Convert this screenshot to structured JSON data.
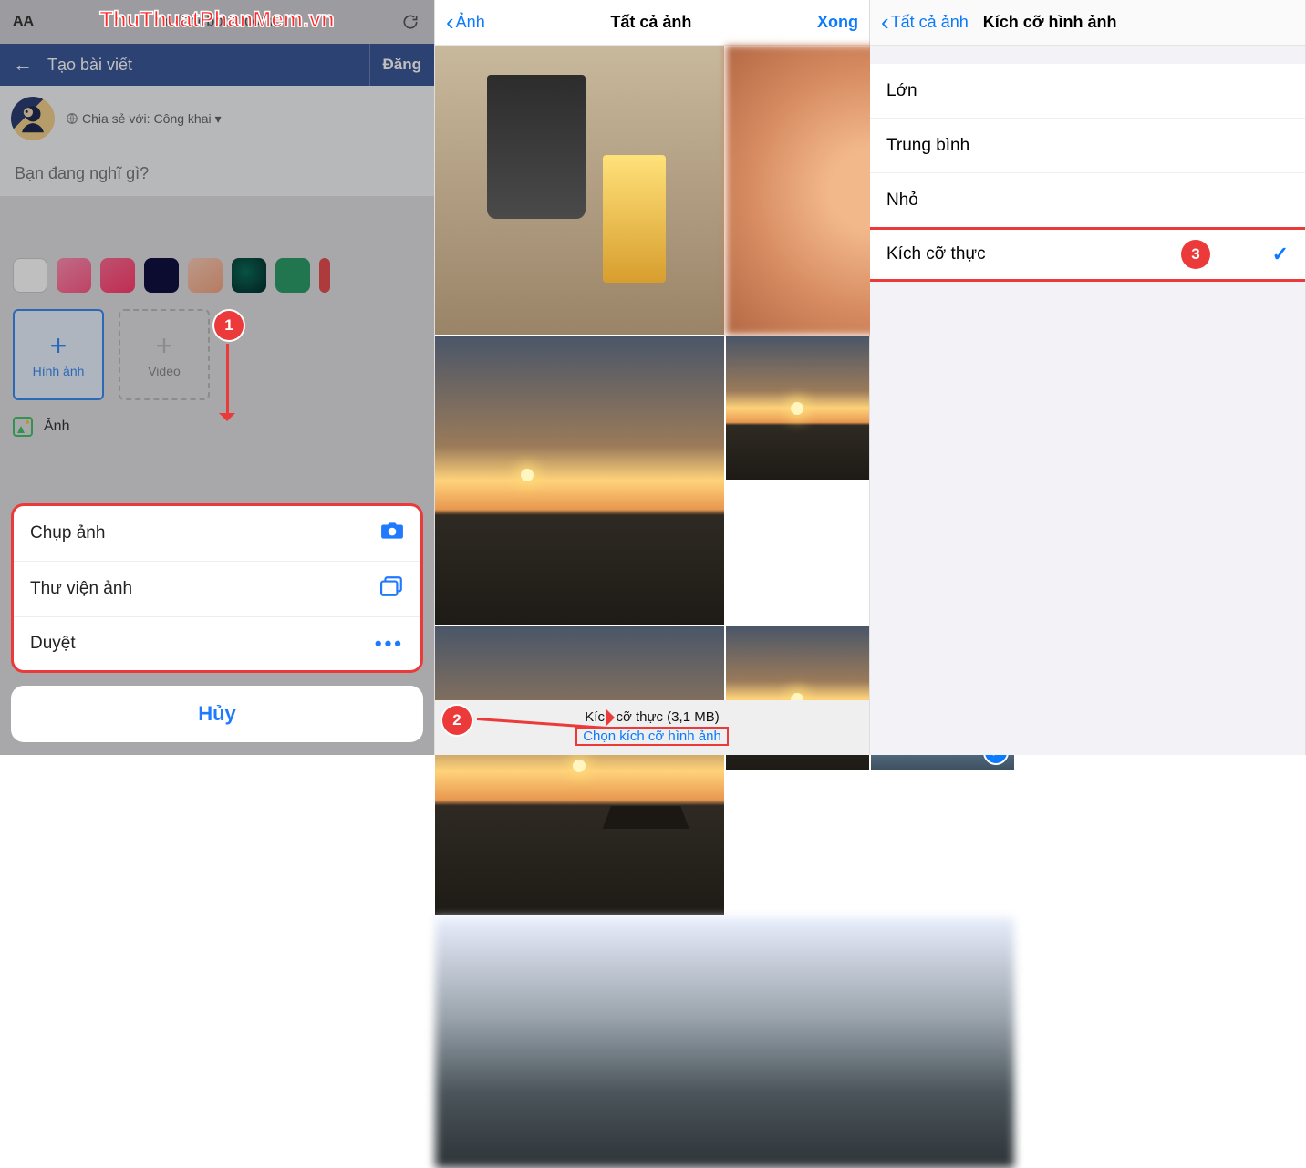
{
  "watermark": "ThuThuatPhanMem.vn",
  "panel1": {
    "safari": {
      "aa": "AA",
      "url": "m.facebook.com"
    },
    "header": {
      "title": "Tạo bài viết",
      "post": "Đăng"
    },
    "share_prefix": "Chia sẻ với:",
    "share_audience": "Công khai",
    "placeholder": "Bạn đang nghĩ gì?",
    "media": {
      "image_label": "Hình ảnh",
      "video_label": "Video"
    },
    "anh_label": "Ảnh",
    "callout1": "1",
    "sheet": {
      "items": [
        {
          "label": "Chụp ảnh",
          "icon": "camera-icon"
        },
        {
          "label": "Thư viện ảnh",
          "icon": "gallery-icon"
        },
        {
          "label": "Duyệt",
          "icon": "more-icon"
        }
      ],
      "cancel": "Hủy"
    }
  },
  "panel2": {
    "nav": {
      "back": "Ảnh",
      "title": "Tất cả ảnh",
      "done": "Xong"
    },
    "footer": {
      "size_label": "Kích cỡ thực (3,1 MB)",
      "choose_label": "Chọn kích cỡ hình ảnh"
    },
    "callout2": "2"
  },
  "panel3": {
    "nav": {
      "back": "Tất cả ảnh",
      "title": "Kích cỡ hình ảnh"
    },
    "options": [
      {
        "label": "Lớn",
        "selected": false
      },
      {
        "label": "Trung bình",
        "selected": false
      },
      {
        "label": "Nhỏ",
        "selected": false
      },
      {
        "label": "Kích cỡ thực",
        "selected": true
      }
    ],
    "callout3": "3"
  }
}
